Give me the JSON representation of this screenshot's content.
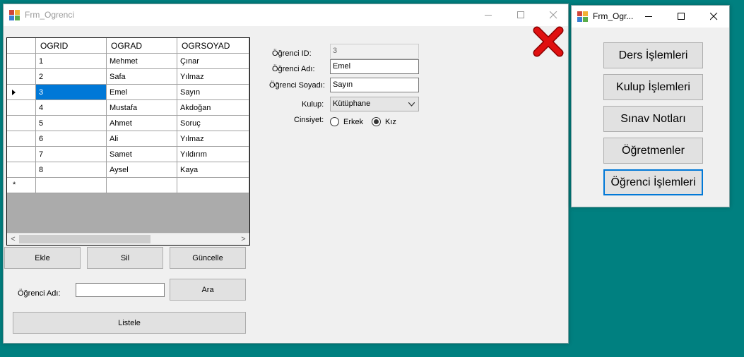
{
  "main_window": {
    "title": "Frm_Ogrenci",
    "grid": {
      "columns": [
        "OGRID",
        "OGRAD",
        "OGRSOYAD"
      ],
      "rows": [
        [
          "1",
          "Mehmet",
          "Çınar"
        ],
        [
          "2",
          "Safa",
          "Yılmaz"
        ],
        [
          "3",
          "Emel",
          "Sayın"
        ],
        [
          "4",
          "Mustafa",
          "Akdoğan"
        ],
        [
          "5",
          "Ahmet",
          "Soruç"
        ],
        [
          "6",
          "Ali",
          "Yılmaz"
        ],
        [
          "7",
          "Samet",
          "Yıldırım"
        ],
        [
          "8",
          "Aysel",
          "Kaya"
        ]
      ],
      "selected_row": 2
    },
    "buttons": {
      "add": "Ekle",
      "delete": "Sil",
      "update": "Güncelle",
      "search": "Ara",
      "list": "Listele"
    },
    "search": {
      "label": "Öğrenci Adı:",
      "value": ""
    },
    "form": {
      "id_label": "Öğrenci ID:",
      "id_value": "3",
      "name_label": "Öğrenci Adı:",
      "name_value": "Emel",
      "surname_label": "Öğrenci Soyadı:",
      "surname_value": "Sayın",
      "club_label": "Kulup:",
      "club_value": "Kütüphane",
      "gender_label": "Cinsiyet:",
      "male_label": "Erkek",
      "female_label": "Kız",
      "selected_gender": "Kız"
    }
  },
  "menu_window": {
    "title": "Frm_Ogr...",
    "buttons": [
      "Ders İşlemleri",
      "Kulup İşlemleri",
      "Sınav Notları",
      "Öğretmenler",
      "Öğrenci İşlemleri"
    ]
  },
  "colors": {
    "desktop": "#008080",
    "selection": "#0078d7",
    "close_x": "#e01010"
  }
}
